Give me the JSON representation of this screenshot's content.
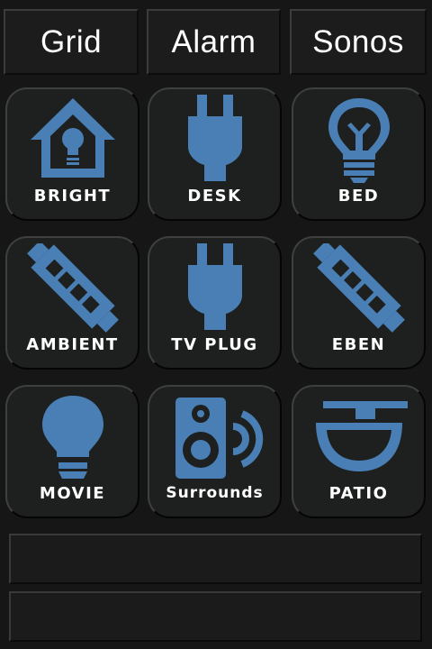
{
  "tabs": [
    {
      "label": "Grid"
    },
    {
      "label": "Alarm"
    },
    {
      "label": "Sonos"
    }
  ],
  "tiles": [
    {
      "label": "BRIGHT",
      "icon": "house-bulb-icon"
    },
    {
      "label": "DESK",
      "icon": "plug-icon"
    },
    {
      "label": "BED",
      "icon": "lightbulb-outline-icon"
    },
    {
      "label": "AMBIENT",
      "icon": "led-strip-icon"
    },
    {
      "label": "TV PLUG",
      "icon": "plug-icon"
    },
    {
      "label": "EBEN",
      "icon": "led-strip-icon"
    },
    {
      "label": "MOVIE",
      "icon": "lightbulb-icon"
    },
    {
      "label": "Surrounds",
      "icon": "speaker-icon"
    },
    {
      "label": "PATIO",
      "icon": "ceiling-lamp-icon"
    }
  ],
  "colors": {
    "background": "#161616",
    "tile": "#1d201f",
    "icon": "#4a7fb5",
    "text": "#ffffff"
  }
}
